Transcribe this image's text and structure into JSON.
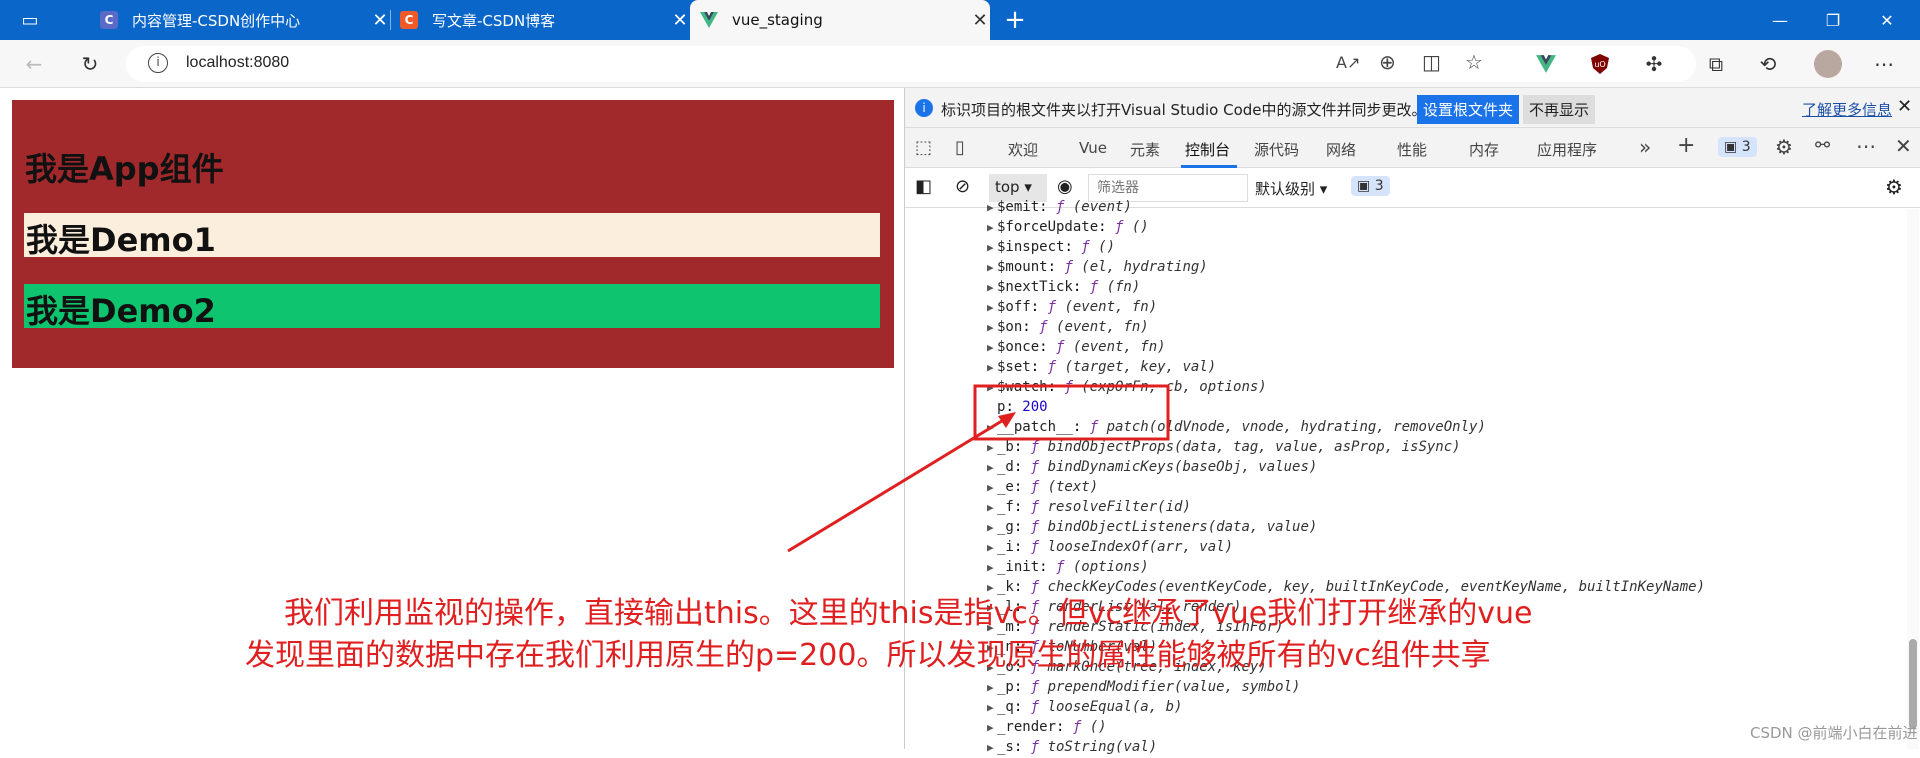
{
  "browser": {
    "tabs": [
      {
        "title": "内容管理-CSDN创作中心",
        "favicon": "C"
      },
      {
        "title": "写文章-CSDN博客",
        "favicon": "C"
      },
      {
        "title": "vue_staging",
        "favicon": "V"
      }
    ],
    "new_tab_label": "+",
    "url": "localhost:8080"
  },
  "page": {
    "app_heading": "我是App组件",
    "demo1_heading": "我是Demo1",
    "demo2_heading": "我是Demo2",
    "colors": {
      "app_bg": "#a2292b",
      "demo1_bg": "#fbeedc",
      "demo2_bg": "#0fc46e"
    }
  },
  "devtools": {
    "infobar": {
      "message": "标识项目的根文件夹以打开Visual Studio Code中的源文件并同步更改。",
      "set_root_button": "设置根文件夹",
      "dismiss_button": "不再显示",
      "learn_more": "了解更多信息"
    },
    "tabs": [
      "欢迎",
      "Vue",
      "元素",
      "控制台",
      "源代码",
      "网络",
      "性能",
      "内存",
      "应用程序"
    ],
    "active_tab": "控制台",
    "issues_count": "3",
    "console_toolbar": {
      "context": "top",
      "filter_placeholder": "筛选器",
      "level": "默认级别",
      "messages_count": "3"
    },
    "console_rows": [
      {
        "key": "$emit",
        "sig": "(event)"
      },
      {
        "key": "$forceUpdate",
        "sig": "()"
      },
      {
        "key": "$inspect",
        "sig": "()"
      },
      {
        "key": "$mount",
        "sig": "(el, hydrating)"
      },
      {
        "key": "$nextTick",
        "sig": "(fn)"
      },
      {
        "key": "$off",
        "sig": "(event, fn)"
      },
      {
        "key": "$on",
        "sig": "(event, fn)"
      },
      {
        "key": "$once",
        "sig": "(event, fn)"
      },
      {
        "key": "$set",
        "sig": "(target, key, val)"
      },
      {
        "key": "$watch",
        "sig": "(expOrFn, cb, options)"
      },
      {
        "key": "p",
        "value": "200"
      },
      {
        "key": "__patch__",
        "sig": "patch(oldVnode, vnode, hydrating, removeOnly)"
      },
      {
        "key": "_b",
        "sig": "bindObjectProps(data, tag, value, asProp, isSync)"
      },
      {
        "key": "_d",
        "sig": "bindDynamicKeys(baseObj, values)"
      },
      {
        "key": "_e",
        "sig": "(text)"
      },
      {
        "key": "_f",
        "sig": "resolveFilter(id)"
      },
      {
        "key": "_g",
        "sig": "bindObjectListeners(data, value)"
      },
      {
        "key": "_i",
        "sig": "looseIndexOf(arr, val)"
      },
      {
        "key": "_init",
        "sig": "(options)"
      },
      {
        "key": "_k",
        "sig": "checkKeyCodes(eventKeyCode, key, builtInKeyCode, eventKeyName, builtInKeyName)"
      },
      {
        "key": "_l",
        "sig": "renderList(val, render)"
      },
      {
        "key": "_m",
        "sig": "renderStatic(index, isInFor)"
      },
      {
        "key": "_n",
        "sig": "toNumber(val)"
      },
      {
        "key": "_o",
        "sig": "markOnce(tree, index, key)"
      },
      {
        "key": "_p",
        "sig": "prependModifier(value, symbol)"
      },
      {
        "key": "_q",
        "sig": "looseEqual(a, b)"
      },
      {
        "key": "_render",
        "sig": "()"
      },
      {
        "key": "_s",
        "sig": "toString(val)"
      }
    ]
  },
  "annotation": {
    "line1": "我们利用监视的操作，直接输出this。这里的this是指vc。但vc继承了vue我们打开继承的vue",
    "line2": "发现里面的数据中存在我们利用原生的p=200。所以发现原生的属性能够被所有的vc组件共享",
    "color": "#e02020"
  },
  "watermark": "CSDN @前端小白在前进"
}
